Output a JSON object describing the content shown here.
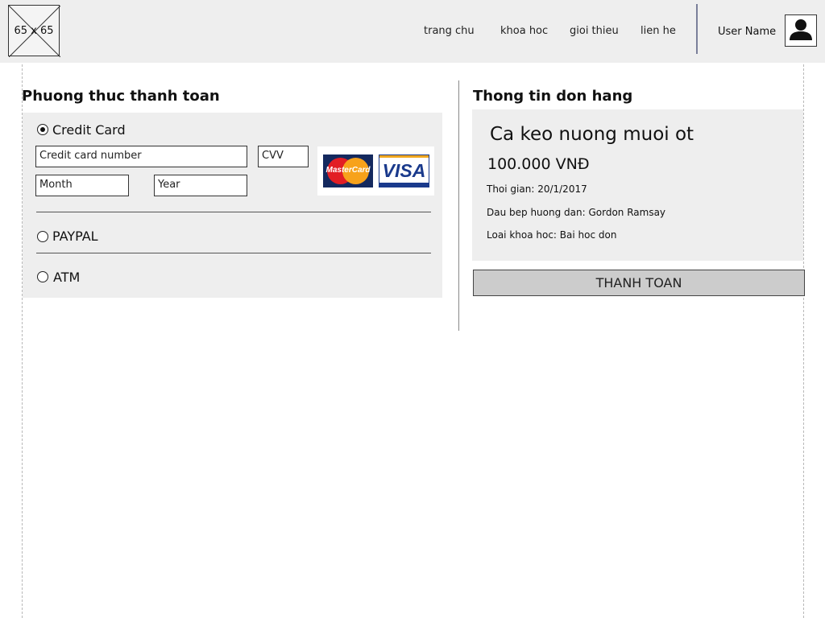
{
  "header": {
    "logo_placeholder": "65 x 65",
    "nav": [
      "trang chu",
      "khoa hoc",
      "gioi thieu",
      "lien he"
    ],
    "user_name": "User Name"
  },
  "payment": {
    "title": "Phuong thuc thanh toan",
    "options": [
      {
        "label": "Credit Card",
        "selected": true
      },
      {
        "label": "PAYPAL",
        "selected": false
      },
      {
        "label": "ATM",
        "selected": false
      }
    ],
    "card_number_placeholder": "Credit card number",
    "cvv_placeholder": "CVV",
    "month_placeholder": "Month",
    "year_placeholder": "Year",
    "card_logos": {
      "mastercard": "MasterCard",
      "visa": "VISA"
    }
  },
  "order": {
    "title": "Thong tin don hang",
    "course_name": "Ca keo nuong muoi ot",
    "price": "100.000 VNĐ",
    "date": "Thoi gian: 20/1/2017",
    "chef": "Dau bep huong dan: Gordon Ramsay",
    "course_type": "Loai khoa hoc: Bai hoc don",
    "pay_button": "THANH TOAN"
  }
}
